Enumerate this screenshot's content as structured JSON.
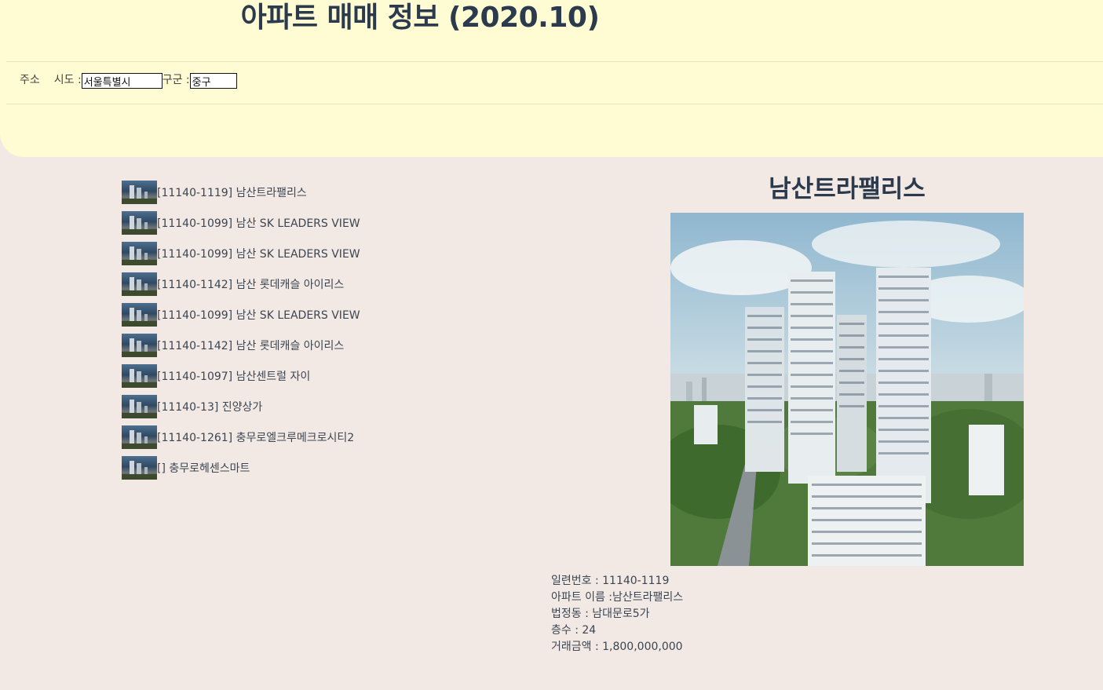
{
  "header": {
    "title": "아파트 매매 정보 (2020.10)"
  },
  "address": {
    "label": "주소",
    "sido_label": "시도 :",
    "sido_value": "서울특별시",
    "gugun_label": "구군 :",
    "gugun_value": "중구"
  },
  "apartments": [
    {
      "text": "[11140-1119] 남산트라팰리스"
    },
    {
      "text": "[11140-1099] 남산 SK LEADERS VIEW"
    },
    {
      "text": "[11140-1099] 남산 SK LEADERS VIEW"
    },
    {
      "text": "[11140-1142] 남산 롯데캐슬 아이리스"
    },
    {
      "text": "[11140-1099] 남산 SK LEADERS VIEW"
    },
    {
      "text": "[11140-1142] 남산 롯데캐슬 아이리스"
    },
    {
      "text": "[11140-1097] 남산센트럴 자이"
    },
    {
      "text": "[11140-13] 진양상가"
    },
    {
      "text": "[11140-1261] 충무로엘크루메크로시티2"
    },
    {
      "text": "[] 충무로헤센스마트"
    }
  ],
  "detail": {
    "title": "남산트라팰리스",
    "serial": "일련번호 : 11140-1119",
    "apt_name": "아파트 이름 :남산트라팰리스",
    "dong": "법정동 : 남대문로5가",
    "floor": "층수 : 24",
    "price": "거래금액 : 1,800,000,000"
  }
}
